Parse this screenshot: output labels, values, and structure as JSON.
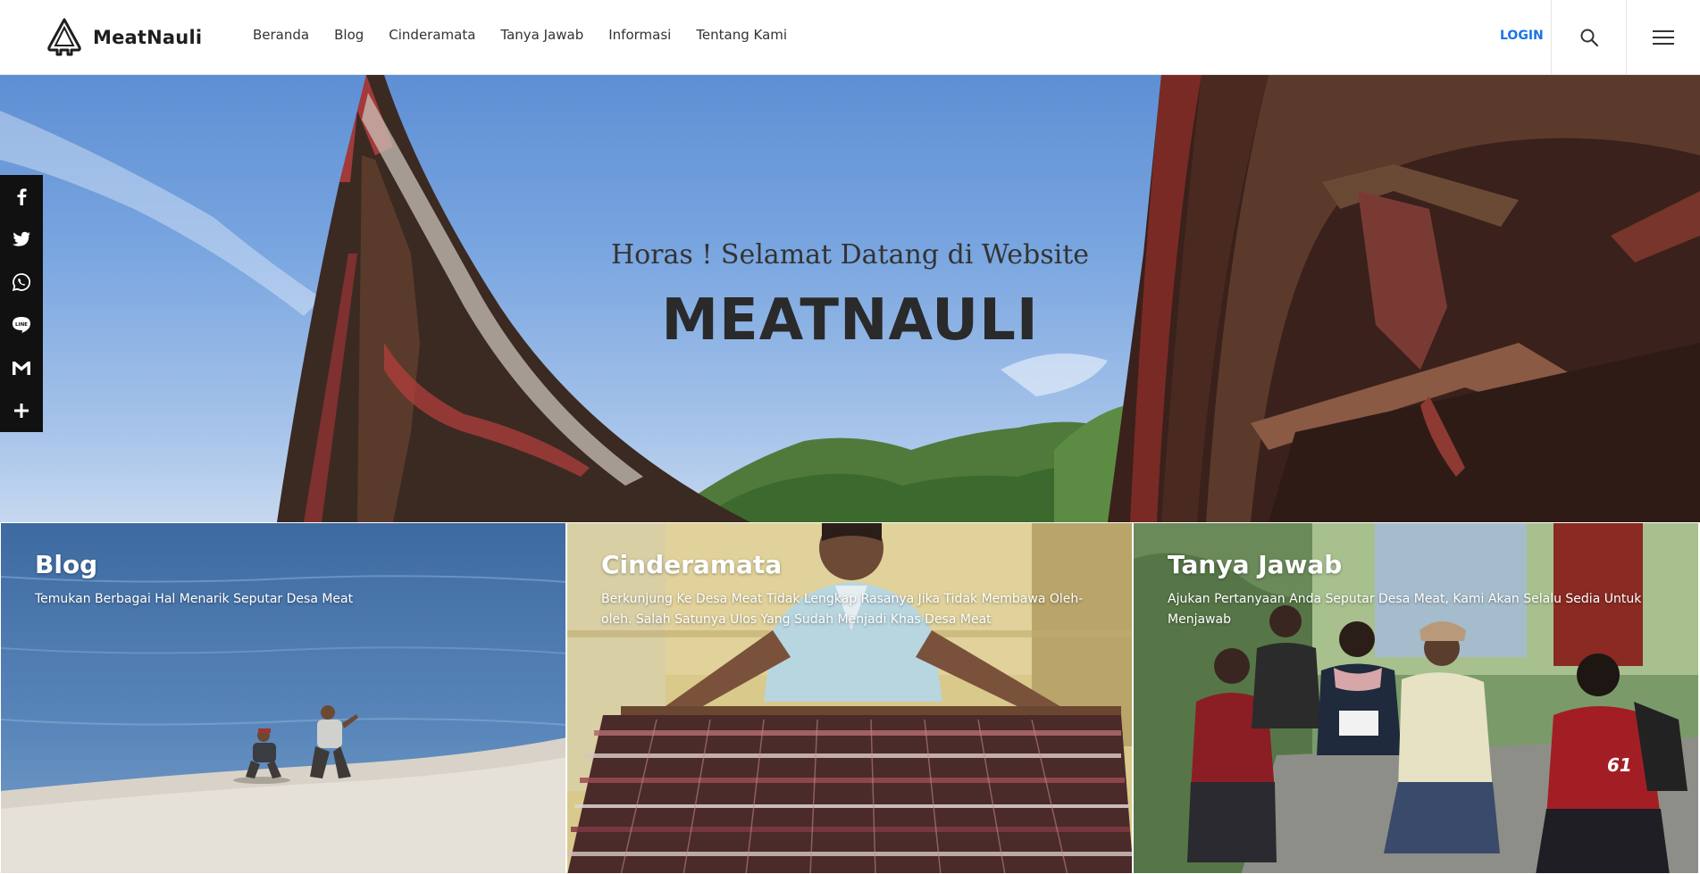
{
  "header": {
    "brand": "MeatNauli",
    "nav": [
      "Beranda",
      "Blog",
      "Cinderamata",
      "Tanya Jawab",
      "Informasi",
      "Tentang Kami"
    ],
    "login_label": "LOGIN"
  },
  "share": {
    "items": [
      "facebook-icon",
      "twitter-icon",
      "whatsapp-icon",
      "line-icon",
      "gmail-icon",
      "more-icon"
    ]
  },
  "hero": {
    "subtitle": "Horas ! Selamat Datang di Website",
    "title": "MEATNAULI"
  },
  "cards": [
    {
      "title": "Blog",
      "description": "Temukan Berbagai Hal Menarik Seputar Desa Meat"
    },
    {
      "title": "Cinderamata",
      "description": "Berkunjung Ke Desa Meat Tidak Lengkap Rasanya Jika Tidak Membawa Oleh-oleh. Salah Satunya Ulos Yang Sudah Menjadi Khas Desa Meat"
    },
    {
      "title": "Tanya Jawab",
      "description": "Ajukan Pertanyaan Anda Seputar Desa Meat, Kami Akan Selalu Sedia Untuk Menjawab"
    }
  ],
  "colors": {
    "accent": "#1a73e8",
    "share_bar": "#111111",
    "sky": "#7aa6e0"
  }
}
